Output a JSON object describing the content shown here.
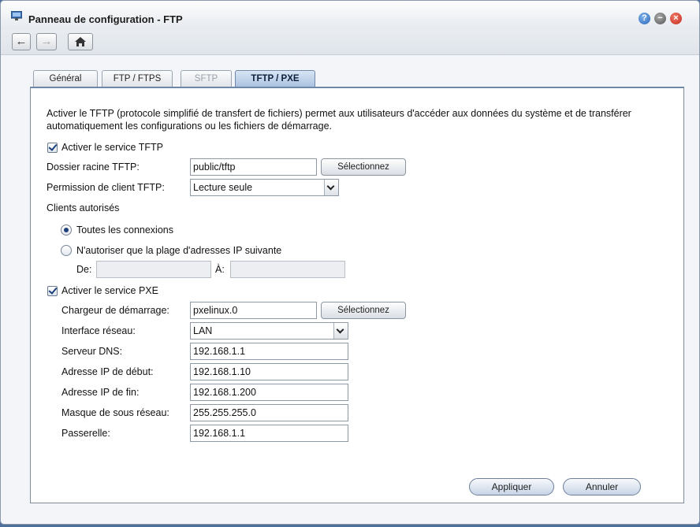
{
  "window": {
    "title": "Panneau de configuration - FTP"
  },
  "titlebar_buttons": {
    "help": "?",
    "minimize": "−",
    "close": "×"
  },
  "nav": {
    "back": "←",
    "forward": "→"
  },
  "tabs": [
    {
      "label": "Général",
      "state": "normal"
    },
    {
      "label": "FTP / FTPS",
      "state": "normal"
    },
    {
      "label": "SFTP",
      "state": "disabled"
    },
    {
      "label": "TFTP / PXE",
      "state": "active"
    }
  ],
  "description": "Activer le TFTP (protocole simplifié de transfert de fichiers) permet aux utilisateurs d'accéder aux données du système et de transférer automatiquement les configurations ou les fichiers de démarrage.",
  "tftp": {
    "enable_label": "Activer le service TFTP",
    "enabled": true,
    "root_label": "Dossier racine TFTP:",
    "root_value": "public/tftp",
    "select_button": "Sélectionnez",
    "permission_label": "Permission de client TFTP:",
    "permission_value": "Lecture seule",
    "clients_label": "Clients autorisés",
    "all_connections_label": "Toutes les connexions",
    "ip_range_label": "N'autoriser que la plage d'adresses IP suivante",
    "from_label": "De:",
    "to_label": "À:",
    "from_value": "",
    "to_value": ""
  },
  "pxe": {
    "enable_label": "Activer le service PXE",
    "enabled": true,
    "boot_loader_label": "Chargeur de démarrage:",
    "boot_loader_value": "pxelinux.0",
    "select_button": "Sélectionnez",
    "interface_label": "Interface réseau:",
    "interface_value": "LAN",
    "dns_label": "Serveur DNS:",
    "dns_value": "192.168.1.1",
    "start_ip_label": "Adresse IP de début:",
    "start_ip_value": "192.168.1.10",
    "end_ip_label": "Adresse IP de fin:",
    "end_ip_value": "192.168.1.200",
    "subnet_label": "Masque de sous réseau:",
    "subnet_value": "255.255.255.0",
    "gateway_label": "Passerelle:",
    "gateway_value": "192.168.1.1"
  },
  "actions": {
    "apply": "Appliquer",
    "cancel": "Annuler"
  }
}
